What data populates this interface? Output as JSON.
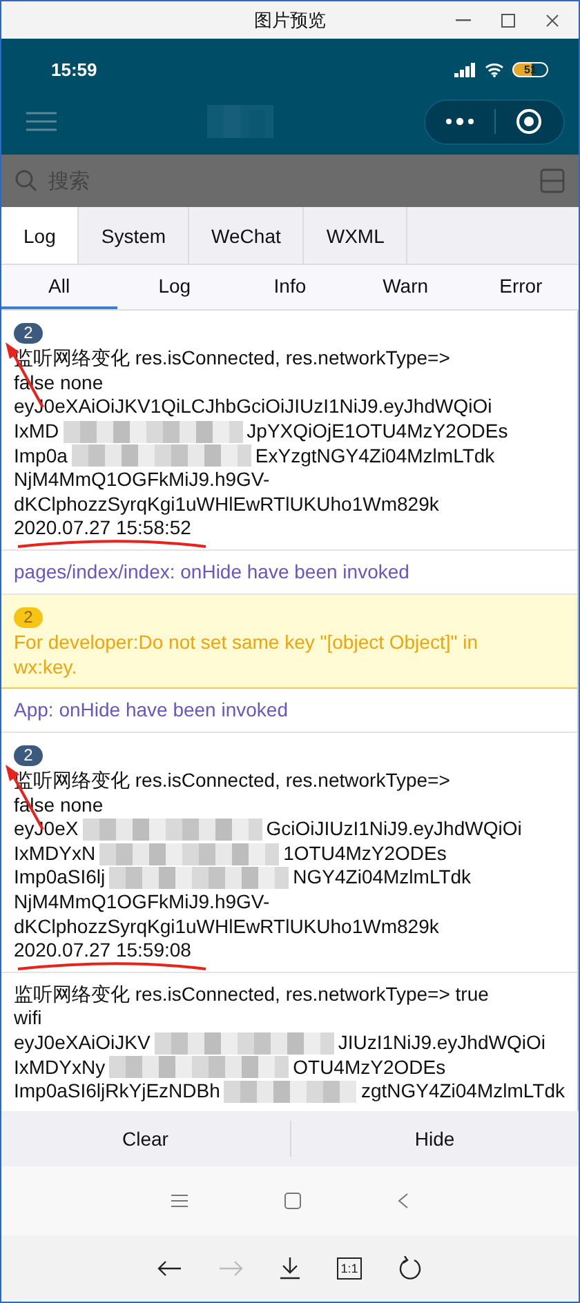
{
  "window": {
    "title": "图片预览"
  },
  "status_bar": {
    "time": "15:59",
    "battery": "51"
  },
  "search": {
    "placeholder": "搜索"
  },
  "tabs": [
    {
      "label": "Log",
      "selected": true
    },
    {
      "label": "System",
      "selected": false
    },
    {
      "label": "WeChat",
      "selected": false
    },
    {
      "label": "WXML",
      "selected": false
    }
  ],
  "filters": [
    {
      "label": "All",
      "selected": true
    },
    {
      "label": "Log",
      "selected": false
    },
    {
      "label": "Info",
      "selected": false
    },
    {
      "label": "Warn",
      "selected": false
    },
    {
      "label": "Error",
      "selected": false
    }
  ],
  "entries": [
    {
      "kind": "log",
      "badge": "2",
      "arrow": true,
      "underline": true,
      "lines": [
        [
          "监听网络变化 res.isConnected, res.networkType=>"
        ],
        [
          "false none"
        ],
        [
          "eyJ0eXAiOiJKV1QiLCJhbGciOiJIUzI1NiJ9.eyJhdWQiOi"
        ],
        [
          "IxMD",
          "JpYXQiOjE1OTU4MzY2ODEs"
        ],
        [
          "Imp0a",
          "ExYzgtNGY4Zi04MzlmLTdk"
        ],
        [
          "NjM4MmQ1OGFkMiJ9.h9GV-"
        ],
        [
          "dKClphozzSyrqKgi1uWHlEwRTlUKUho1Wm829k"
        ]
      ],
      "time": "2020.07.27 15:58:52"
    },
    {
      "kind": "info",
      "text": "pages/index/index: onHide have been invoked"
    },
    {
      "kind": "warn",
      "badge": "2",
      "text": "For developer:Do not set same key \"[object Object]\" in wx:key."
    },
    {
      "kind": "info",
      "text": "App: onHide have been invoked"
    },
    {
      "kind": "log",
      "badge": "2",
      "arrow": true,
      "underline": true,
      "lines": [
        [
          "监听网络变化 res.isConnected, res.networkType=>"
        ],
        [
          "false none"
        ],
        [
          "eyJ0eX",
          "GciOiJIUzI1NiJ9.eyJhdWQiOi"
        ],
        [
          "IxMDYxN",
          "1OTU4MzY2ODEs"
        ],
        [
          "Imp0aSI6lj",
          "NGY4Zi04MzlmLTdk"
        ],
        [
          "NjM4MmQ1OGFkMiJ9.h9GV-"
        ],
        [
          "dKClphozzSyrqKgi1uWHlEwRTlUKUho1Wm829k"
        ]
      ],
      "time": "2020.07.27 15:59:08"
    },
    {
      "kind": "log",
      "arrow": false,
      "underline": false,
      "lines": [
        [
          "监听网络变化 res.isConnected, res.networkType=> true"
        ],
        [
          "wifi"
        ],
        [
          "eyJ0eXAiOiJKV",
          "JIUzI1NiJ9.eyJhdWQiOi"
        ],
        [
          "IxMDYxNy",
          "OTU4MzY2ODEs"
        ],
        [
          "Imp0aSI6ljRkYjEzNDBh",
          "zgtNGY4Zi04MzlmLTdk"
        ]
      ]
    }
  ],
  "actions": [
    "Clear",
    "Hide"
  ],
  "viewer_toolbar": {
    "forward_disabled": true,
    "actual_size": "1:1"
  }
}
